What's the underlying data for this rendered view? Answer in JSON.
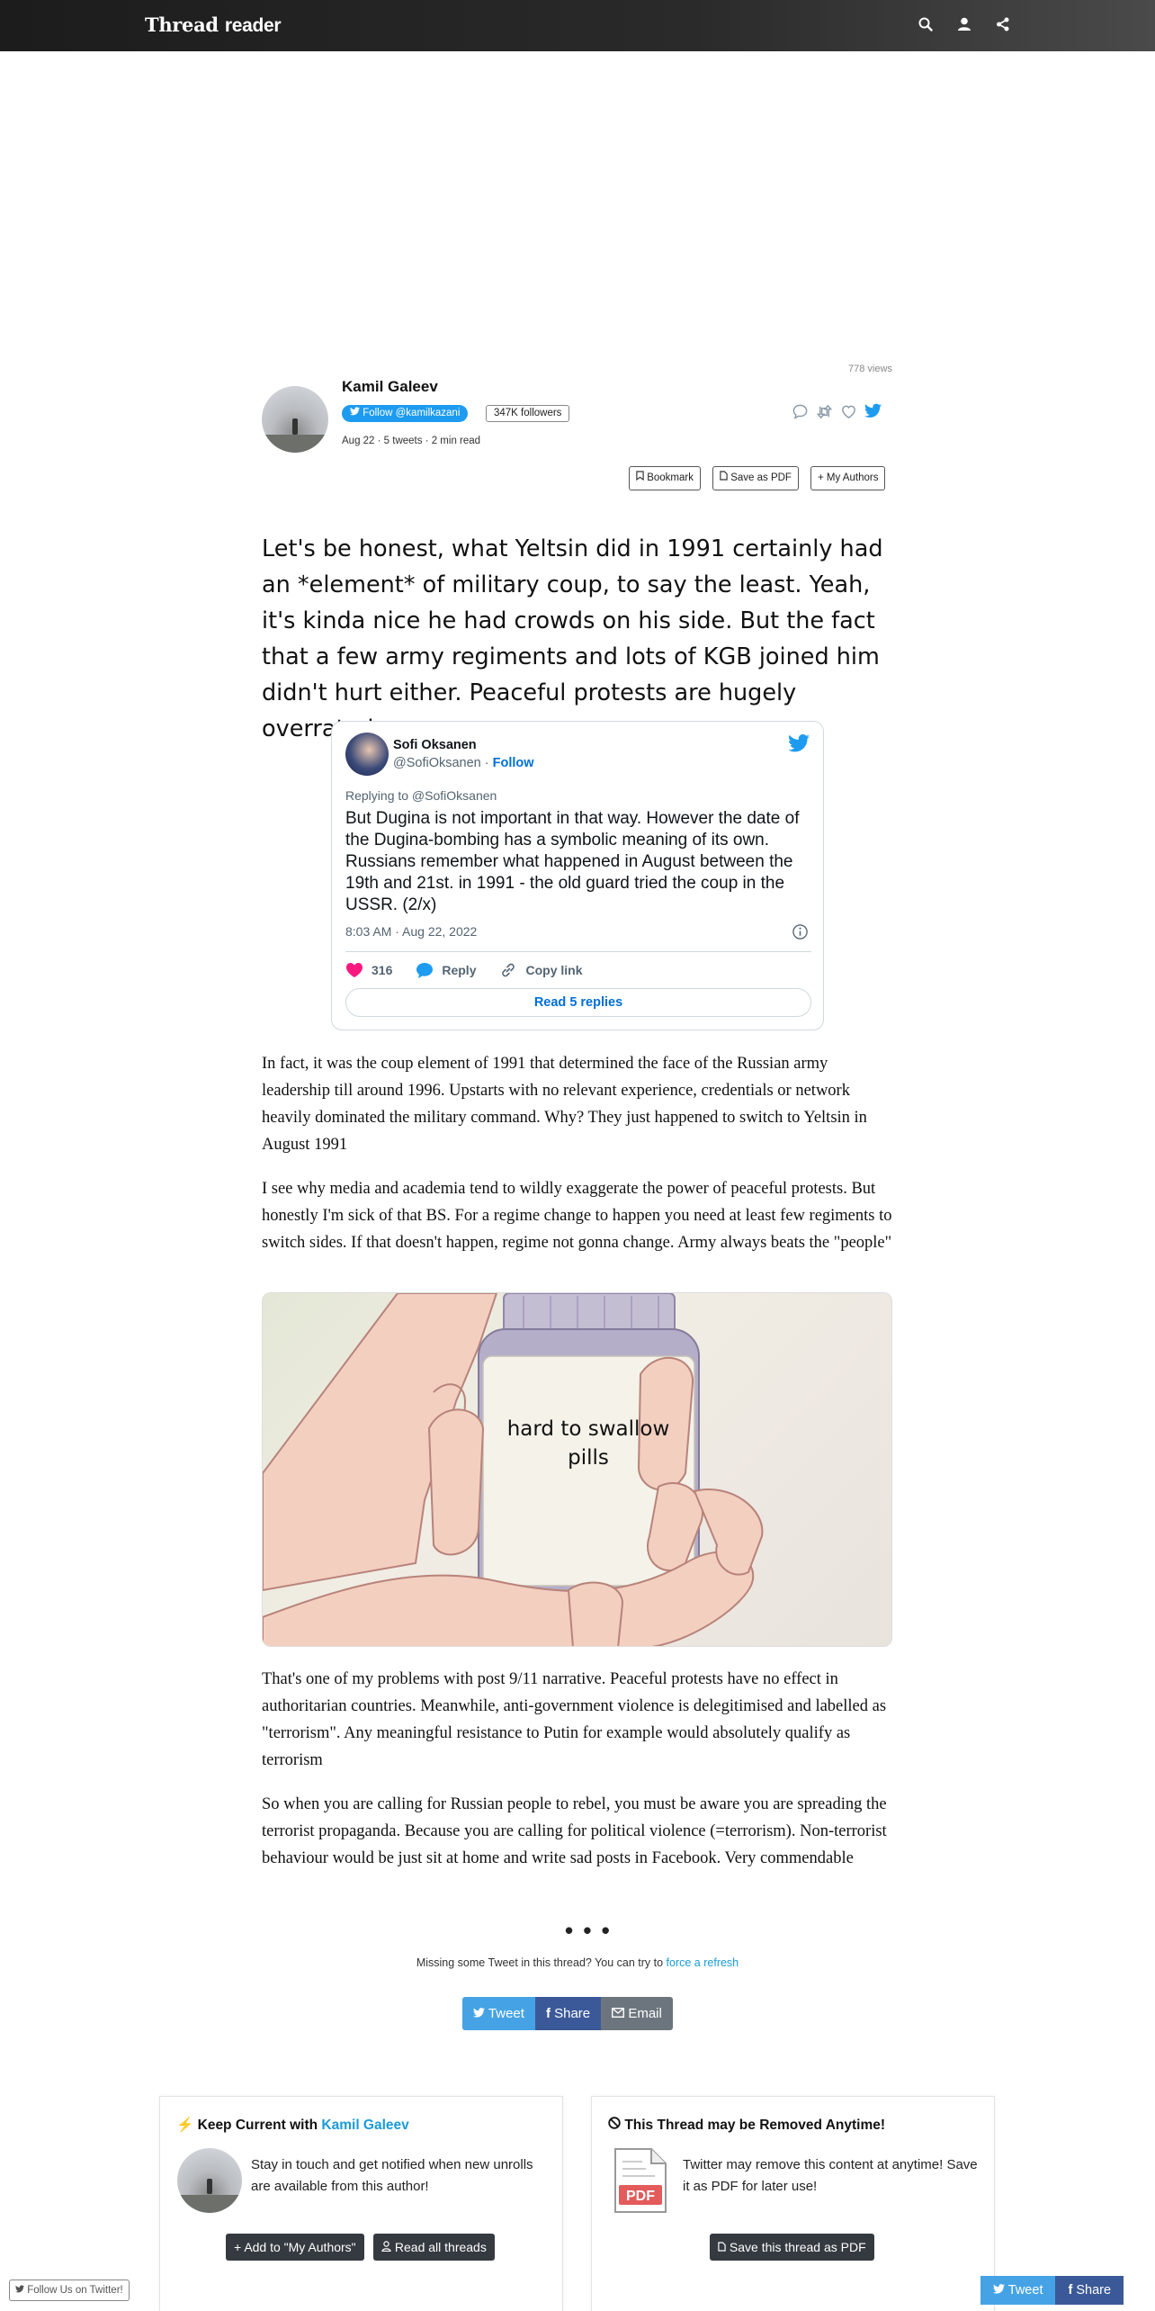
{
  "app": {
    "brand_part1": "Thread",
    "brand_part2": "reader"
  },
  "header": {
    "views": "778 views",
    "author_name": "Kamil Galeev",
    "follow_label": "Follow @kamilkazani",
    "followers": "347K followers",
    "meta": "Aug 22 · 5 tweets · 2 min read",
    "bookmark_label": "Bookmark",
    "save_pdf_label": "Save as PDF",
    "my_authors_label": "My Authors"
  },
  "thread": {
    "lead": "Let's be honest, what Yeltsin did in 1991 certainly had an *element* of military coup, to say the least. Yeah, it's kinda nice he had crowds on his side. But the fact that a few army regiments and lots of KGB joined him didn't hurt either. Peaceful protests are hugely overrated",
    "para2": "In fact, it was the coup element of 1991 that determined the face of the Russian army leadership till around 1996. Upstarts with no relevant experience, credentials or network heavily dominated the military command. Why? They just happened to switch to Yeltsin in August 1991",
    "para3": "I see why media and academia tend to wildly exaggerate the power of peaceful protests. But honestly I'm sick of that BS. For a regime change to happen you need at least few regiments to switch sides. If that doesn't happen, regime not gonna change. Army always beats the \"people\"",
    "meme_text_line1": "hard to swallow",
    "meme_text_line2": "pills",
    "para4": "That's one of my problems with post 9/11 narrative. Peaceful protests have no effect in authoritarian countries. Meanwhile, anti-government violence is delegitimised and labelled as \"terrorism\". Any meaningful resistance to Putin for example would absolutely qualify as terrorism",
    "para5": "So when you are calling for Russian people to rebel, you must be aware you are spreading the terrorist propaganda. Because you are calling for political violence (=terrorism). Non-terrorist behaviour would be just sit at home and write sad posts in Facebook. Very commendable",
    "dots": "• • •",
    "missing_text": "Missing some Tweet in this thread? You can try to ",
    "missing_link": "force a refresh"
  },
  "embedded_tweet": {
    "name": "Sofi Oksanen",
    "handle": "@SofiOksanen",
    "separator": " · ",
    "follow": "Follow",
    "replying_to": "Replying to @SofiOksanen",
    "text": "But Dugina is not important in that way.  However the date of the Dugina-bombing has a symbolic meaning of its own. Russians remember what happened in August between the 19th and 21st. in 1991 - the old guard tried the coup in the USSR. (2/x)",
    "time": "8:03 AM · Aug 22, 2022",
    "likes": "316",
    "reply_label": "Reply",
    "copy_label": "Copy link",
    "read_replies": "Read 5 replies"
  },
  "share": {
    "tweet": "Tweet",
    "share": "Share",
    "email": "Email"
  },
  "keep_current": {
    "title_prefix": "Keep Current with ",
    "title_author": "Kamil Galeev",
    "body": "Stay in touch and get notified when new unrolls are available from this author!",
    "add_label": "Add to \"My Authors\"",
    "read_all_label": "Read all threads"
  },
  "removed": {
    "title": "This Thread may be Removed Anytime!",
    "body": "Twitter may remove this content at anytime! Save it as PDF for later use!",
    "pdf_badge": "PDF",
    "save_label": "Save this thread as PDF"
  },
  "footer": {
    "follow_us": "Follow Us on Twitter!",
    "tweet": "Tweet",
    "share": "Share"
  },
  "colors": {
    "twitter_blue": "#1d9bf0",
    "facebook_blue": "#3b5998",
    "link_blue": "#1a9bd7",
    "dark_button": "#343a40",
    "like_pink": "#f91880"
  }
}
